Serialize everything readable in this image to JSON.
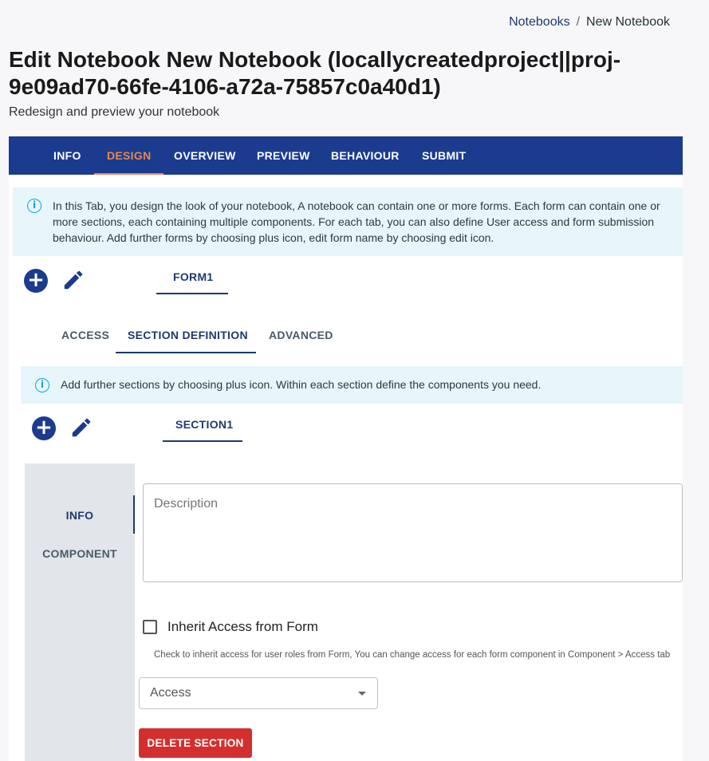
{
  "breadcrumb": {
    "parent": "Notebooks",
    "separator": "/",
    "current": "New Notebook"
  },
  "page": {
    "title": "Edit Notebook New Notebook (locallycreatedproject||proj-9e09ad70-66fe-4106-a72a-75857c0a40d1)",
    "subtitle": "Redesign and preview your notebook"
  },
  "main_tabs": [
    "INFO",
    "DESIGN",
    "OVERVIEW",
    "PREVIEW",
    "BEHAVIOUR",
    "SUBMIT"
  ],
  "active_main_tab": "DESIGN",
  "design_info": "In this Tab, you design the look of your notebook, A notebook can contain one or more forms. Each form can contain one or more sections, each containing multiple components. For each tab, you can also define User access and form submission behaviour. Add further forms by choosing plus icon, edit form name by choosing edit icon.",
  "form_tabs": [
    "FORM1"
  ],
  "form_subtabs": [
    "ACCESS",
    "SECTION DEFINITION",
    "ADVANCED"
  ],
  "active_form_subtab": "SECTION DEFINITION",
  "section_info": "Add further sections by choosing plus icon. Within each section define the components you need.",
  "section_tabs": [
    "SECTION1"
  ],
  "section_nav": [
    "INFO",
    "COMPONENT"
  ],
  "active_section_nav": "INFO",
  "description": {
    "placeholder": "Description",
    "value": ""
  },
  "inherit_access": {
    "label": "Inherit Access from Form",
    "checked": false,
    "helper": "Check to inherit access for user roles from Form, You can change access for each form component in Component > Access tab"
  },
  "access_select": {
    "value": "Access"
  },
  "delete_button": "DELETE SECTION",
  "colors": {
    "primary": "#1b3b8f",
    "accent": "#e8874e",
    "danger": "#d32f2f",
    "info_bg": "#e6f6fb",
    "info_icon": "#17a2d6"
  },
  "icons": {
    "add": "plus-circle-icon",
    "edit": "pencil-icon",
    "info": "info-circle-icon",
    "dropdown": "caret-down-icon"
  }
}
